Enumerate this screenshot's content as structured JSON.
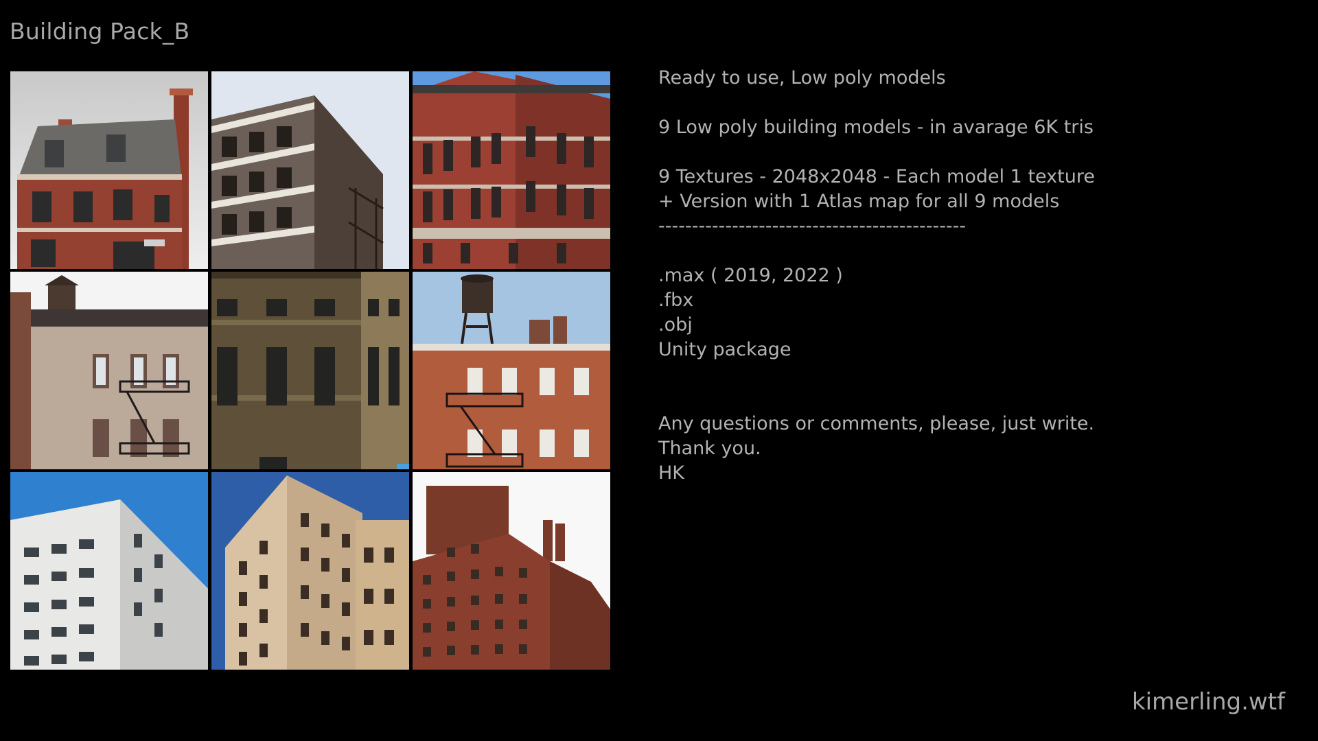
{
  "header": {
    "title": "Building Pack_B"
  },
  "description": {
    "block1": [
      "Ready to use, Low poly models"
    ],
    "block2": [
      "9 Low poly building models - in avarage 6K tris"
    ],
    "block3": [
      "9 Textures - 2048x2048 - Each model 1 texture",
      "+ Version with 1 Atlas map for all 9 models",
      "----------------------------------------------"
    ],
    "block4": [
      ".max ( 2019, 2022 )",
      ".fbx",
      ".obj",
      "Unity package"
    ],
    "block5": [
      "Any questions or comments, please, just write.",
      "Thank you.",
      "HK"
    ]
  },
  "footer": {
    "website": "kimerling.wtf"
  },
  "colors": {
    "background": "#000000",
    "text": "#b3b3b3",
    "brick_red": "#8a3a2a",
    "sky_blue": "#2f7fd0"
  }
}
